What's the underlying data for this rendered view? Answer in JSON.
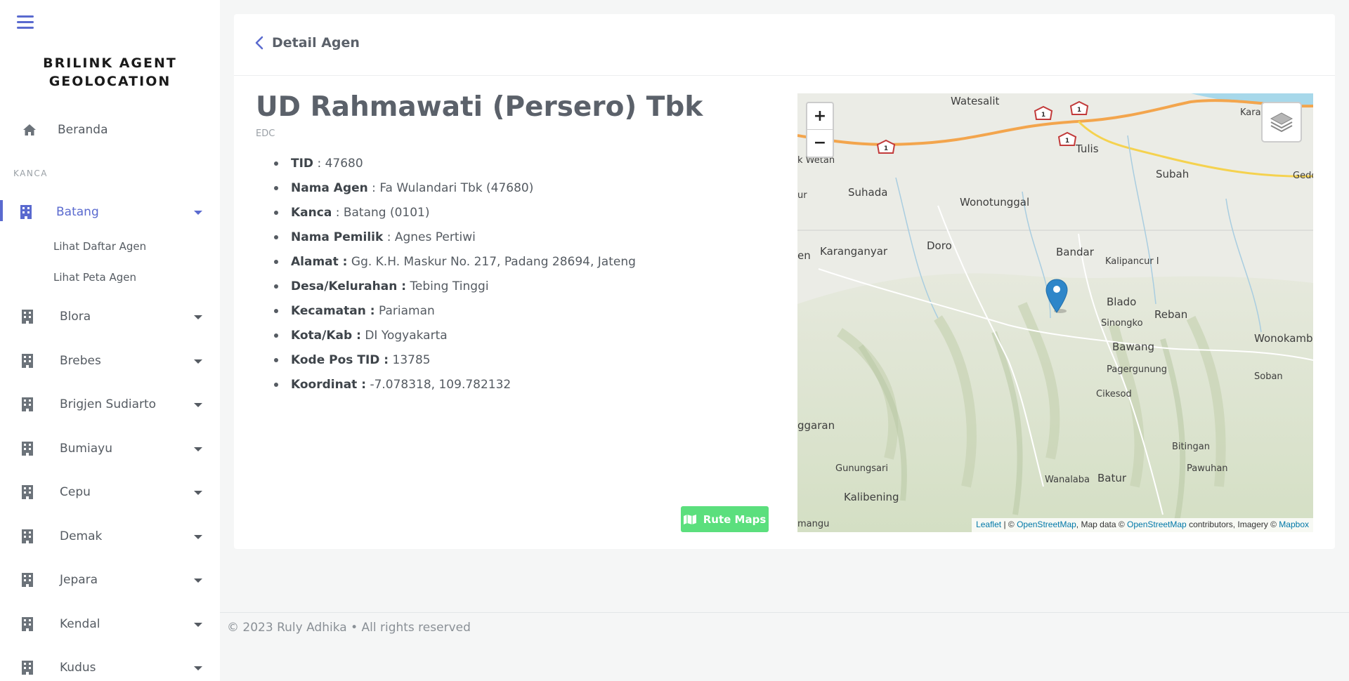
{
  "sidebar": {
    "brand_line1": "BRILINK AGENT",
    "brand_line2": "GEOLOCATION",
    "home_label": "Beranda",
    "section_label": "KANCA",
    "items": [
      {
        "label": "Batang",
        "active": true
      },
      {
        "label": "Blora"
      },
      {
        "label": "Brebes"
      },
      {
        "label": "Brigjen Sudiarto"
      },
      {
        "label": "Bumiayu"
      },
      {
        "label": "Cepu"
      },
      {
        "label": "Demak"
      },
      {
        "label": "Jepara"
      },
      {
        "label": "Kendal"
      },
      {
        "label": "Kudus"
      }
    ],
    "sub_items": [
      "Lihat Daftar Agen",
      "Lihat Peta Agen"
    ],
    "accent_color": "#5a6acf"
  },
  "header": {
    "title": "Detail Agen"
  },
  "agent": {
    "name": "UD Rahmawati (Persero) Tbk",
    "type": "EDC",
    "details": [
      {
        "label": "TID",
        "sep": " : ",
        "value": "47680"
      },
      {
        "label": "Nama Agen",
        "sep": " : ",
        "value": "Fa Wulandari Tbk (47680)"
      },
      {
        "label": "Kanca",
        "sep": " : ",
        "value": "Batang (0101)"
      },
      {
        "label": "Nama Pemilik",
        "sep": " : ",
        "value": "Agnes Pertiwi"
      },
      {
        "label": "Alamat :",
        "sep": " ",
        "value": "Gg. K.H. Maskur No. 217, Padang 28694, Jateng"
      },
      {
        "label": "Desa/Kelurahan :",
        "sep": " ",
        "value": "Tebing Tinggi"
      },
      {
        "label": "Kecamatan :",
        "sep": " ",
        "value": "Pariaman"
      },
      {
        "label": "Kota/Kab :",
        "sep": " ",
        "value": "DI Yogyakarta"
      },
      {
        "label": "Kode Pos TID :",
        "sep": " ",
        "value": "13785"
      },
      {
        "label": "Koordinat :",
        "sep": " ",
        "value": "-7.078318, 109.782132"
      }
    ]
  },
  "route_button": {
    "label": "Rute Maps",
    "color": "#5bdf7d"
  },
  "map": {
    "zoom_in": "+",
    "zoom_out": "−",
    "places": [
      {
        "name": "Watesalit"
      },
      {
        "name": "Karangsari"
      },
      {
        "name": "k Wetan"
      },
      {
        "name": "Tulis"
      },
      {
        "name": "Subah"
      },
      {
        "name": "Gedor"
      },
      {
        "name": "ur"
      },
      {
        "name": "Suhada"
      },
      {
        "name": "Wonotunggal"
      },
      {
        "name": "en"
      },
      {
        "name": "Karanganyar"
      },
      {
        "name": "Doro"
      },
      {
        "name": "Bandar"
      },
      {
        "name": "Kalipancur I"
      },
      {
        "name": "Blado"
      },
      {
        "name": "Reban"
      },
      {
        "name": "Sinongko"
      },
      {
        "name": "Bawang"
      },
      {
        "name": "Wonokamba"
      },
      {
        "name": "Pagergunung"
      },
      {
        "name": "Soban"
      },
      {
        "name": "Cikesod"
      },
      {
        "name": "ggaran"
      },
      {
        "name": "Bitingan"
      },
      {
        "name": "Gunungsari"
      },
      {
        "name": "Pawuhan"
      },
      {
        "name": "Wanalaba"
      },
      {
        "name": "Batur"
      },
      {
        "name": "Kalibening"
      },
      {
        "name": "mangu"
      }
    ],
    "road_labels": [
      "1",
      "1",
      "1",
      "1"
    ],
    "attribution": {
      "leaflet": "Leaflet",
      "sep1": " | © ",
      "osm1": "OpenStreetMap",
      "mid": ", Map data © ",
      "osm2": "OpenStreetMap",
      "mid2": " contributors, Imagery © ",
      "mapbox": "Mapbox"
    }
  },
  "footer": {
    "text": "© 2023 Ruly Adhika • All rights reserved"
  }
}
